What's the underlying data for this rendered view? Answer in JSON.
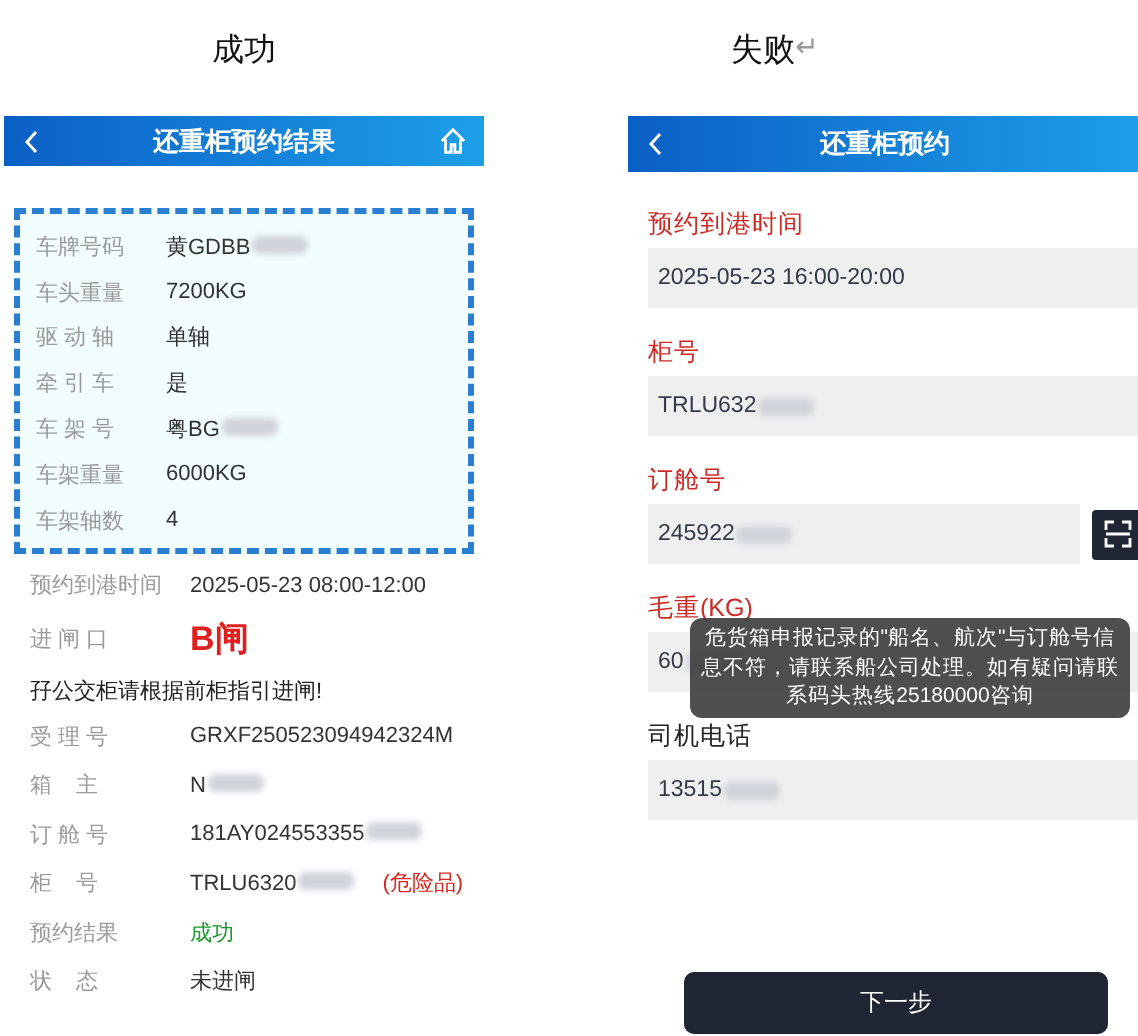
{
  "captions": {
    "success": "成功",
    "failure": "失败",
    "paragraph_mark": "↵"
  },
  "success_screen": {
    "header": {
      "title": "还重柜预约结果"
    },
    "vehicle": [
      {
        "label": "车牌号码",
        "value": "黄GDBB",
        "redacted": true
      },
      {
        "label": "车头重量",
        "value": "7200KG",
        "redacted": false
      },
      {
        "label": "驱 动 轴",
        "value": "单轴",
        "redacted": false
      },
      {
        "label": "牵 引 车",
        "value": "是",
        "redacted": false
      },
      {
        "label": "车 架 号",
        "value": "粤BG",
        "redacted": true
      },
      {
        "label": "车架重量",
        "value": "6000KG",
        "redacted": false
      },
      {
        "label": "车架轴数",
        "value": "4",
        "redacted": false
      }
    ],
    "details": [
      {
        "kind": "text",
        "label": "预约到港时间",
        "value": "2025-05-23 08:00-12:00",
        "redacted": false
      },
      {
        "kind": "gate",
        "label": "进 闸 口",
        "value": "B闸",
        "redacted": false
      },
      {
        "kind": "notice",
        "value": "孖公交柜请根据前柜指引进闸!"
      },
      {
        "kind": "text",
        "label": "受 理 号",
        "value": "GRXF250523094942324M",
        "redacted": false
      },
      {
        "kind": "text",
        "label": "箱    主",
        "value": "N",
        "redacted": true
      },
      {
        "kind": "text",
        "label": "订 舱 号",
        "value": "181AY024553355",
        "redacted": true
      },
      {
        "kind": "text",
        "label": "柜    号",
        "value": "TRLU6320",
        "redacted": true,
        "tag": "(危险品)"
      },
      {
        "kind": "success",
        "label": "预约结果",
        "value": "成功",
        "redacted": false
      },
      {
        "kind": "text",
        "label": "状    态",
        "value": "未进闸",
        "redacted": false
      }
    ]
  },
  "failure_screen": {
    "header": {
      "title": "还重柜预约"
    },
    "fields": [
      {
        "label": "预约到港时间",
        "required": true,
        "value": "2025-05-23 16:00-20:00",
        "redacted": false,
        "scan": false
      },
      {
        "label": "柜号",
        "required": true,
        "value": "TRLU632",
        "redacted": true,
        "scan": false
      },
      {
        "label": "订舱号",
        "required": true,
        "value": "245922",
        "redacted": true,
        "scan": true
      },
      {
        "label": "毛重(KG)",
        "required": true,
        "value": "60",
        "redacted": true,
        "scan": false
      },
      {
        "label": "司机电话",
        "required": false,
        "value": "13515",
        "redacted": true,
        "scan": false
      }
    ],
    "toast": "危货箱申报记录的\"船名、航次\"与订舱号信息不符，请联系船公司处理。如有疑问请联系码头热线25180000咨询",
    "next_button": "下一步"
  }
}
